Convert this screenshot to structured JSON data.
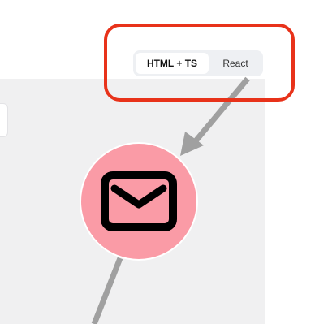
{
  "tabs": {
    "items": [
      {
        "label": "HTML + TS",
        "active": true
      },
      {
        "label": "React",
        "active": false
      }
    ]
  },
  "node": {
    "icon": "mail-icon",
    "color": "#fa9ba6"
  },
  "colors": {
    "highlight": "#e8321a",
    "connector": "#a0a0a0",
    "canvas": "#f0f0f1"
  }
}
